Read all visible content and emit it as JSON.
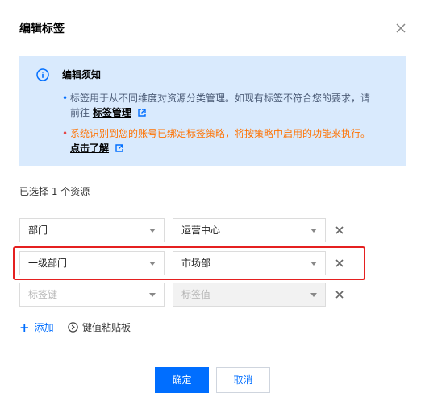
{
  "dialog": {
    "title": "编辑标签",
    "notice": {
      "title": "编辑须知",
      "line1": "标签用于从不同维度对资源分类管理。如现有标签不符合您的要求，请",
      "line2_prefix": "前往",
      "line2_link": "标签管理",
      "line3": "系统识别到您的账号已绑定标签策略，将按策略中启用的功能来执行。",
      "line4_link": "点击了解"
    },
    "selected_text": "已选择 1 个资源",
    "rows": [
      {
        "key": "部门",
        "value": "运营中心"
      },
      {
        "key": "一级部门",
        "value": "市场部"
      },
      {
        "key_placeholder": "标签键",
        "value_placeholder": "标签值"
      }
    ],
    "add_label": "添加",
    "clipboard_label": "键值粘贴板",
    "ok_label": "确定",
    "cancel_label": "取消"
  },
  "colors": {
    "primary": "#006eff",
    "notice_bg": "#d9eafd",
    "warning_text": "#ff7200",
    "highlight_border": "#e52020"
  },
  "icons": [
    "close-icon",
    "info-icon",
    "external-link-icon",
    "chevron-down-icon",
    "remove-icon",
    "plus-icon",
    "clipboard-icon"
  ]
}
